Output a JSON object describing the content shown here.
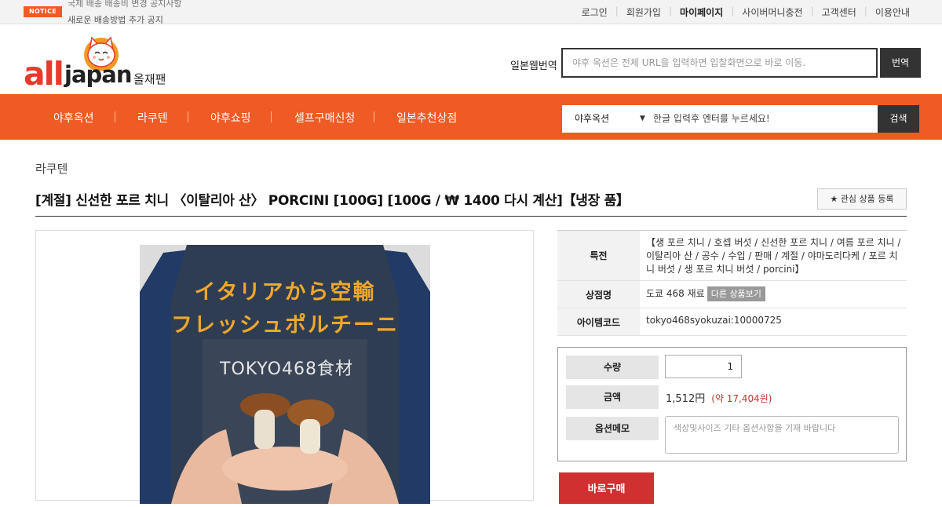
{
  "topbar": {
    "notice_badge": "NOTICE",
    "notice_line1": "국제 배송 배송비 변경 공지사항",
    "notice_line2": "새로운 배송방법 추가 공지",
    "links": [
      "로그인",
      "회원가입",
      "마이페이지",
      "사이버머니충전",
      "고객센터",
      "이용안내"
    ]
  },
  "logo": {
    "all": "all",
    "japan": "japan",
    "korean": "올재팬"
  },
  "translate": {
    "label": "일본웹번역",
    "placeholder": "야후 옥션은 전체 URL을 입력하면 입찰화면으로 바로 이동.",
    "button": "번역"
  },
  "nav": {
    "items": [
      "야후옥션",
      "라쿠텐",
      "야후쇼핑",
      "셀프구매신청",
      "일본추천상점"
    ],
    "search_category": "야후옥션",
    "search_placeholder": "한글 입력후 엔터를 누르세요!",
    "search_button": "검색"
  },
  "product": {
    "breadcrumb": "라쿠텐",
    "title": "[계절] 신선한 포르 치니 〈이탈리아 산〉 PORCINI [100G] [100G / ₩ 1400 다시 계산]【냉장 품】",
    "wish_button": "★ 관심 상품 등록",
    "image_text_line1": "イタリアから空輸",
    "image_text_line2": "フレッシュポルチーニ",
    "image_brand": "TOKYO468食材"
  },
  "info": {
    "feature_label": "특전",
    "feature_value": "【생 포르 치니 / 호셉 버섯 / 신선한 포르 치니 / 여름 포르 치니 / 이탈리아 산 / 공수 / 수입 / 판매 / 계절 / 야마도리다케 / 포르 치니 버섯 / 생 포르 치니 버섯 / porcini】",
    "shop_label": "상점명",
    "shop_value": "도쿄 468 재료",
    "shop_more": "다른 상품보기",
    "code_label": "아이템코드",
    "code_value": "tokyo468syokuzai:10000725"
  },
  "order": {
    "qty_label": "수량",
    "qty_value": "1",
    "price_label": "금액",
    "price_value": "1,512円",
    "price_krw": "(약 17,404원)",
    "memo_label": "옵션메모",
    "memo_placeholder": "색상및사이즈 기타 옵션사항을 기재 바랍니다",
    "buy_button": "바로구매"
  },
  "colors": {
    "brand_orange": "#f05a24",
    "logo_red": "#e83a2a",
    "buy_red": "#d0302f",
    "price_red": "#c0392b"
  }
}
